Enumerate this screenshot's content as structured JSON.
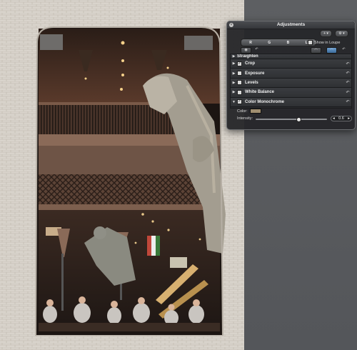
{
  "hud": {
    "title": "Adjustments",
    "close_glyph": "×",
    "toolbar_icons": [
      "add-icon",
      "gear-icon"
    ],
    "toolbar_glyphs": {
      "add": "+ ▾",
      "gear": "⚙ ▾"
    },
    "key_buttons": [
      "R",
      "G",
      "B",
      "L"
    ],
    "show_in_loupe_label": "Show in Loupe",
    "row2_glyphs": {
      "target": "◉",
      "undo": "↶",
      "eye_left": "◠",
      "eye_right": "◠",
      "revert": "↶"
    },
    "partial_row_label": "Straighten",
    "adjustments": [
      {
        "label": "Crop",
        "checked": true
      },
      {
        "label": "Exposure",
        "checked": false
      },
      {
        "label": "Levels",
        "checked": false
      },
      {
        "label": "White Balance",
        "checked": false
      },
      {
        "label": "Color Monochrome",
        "checked": true,
        "expanded": true
      }
    ],
    "collapsed_glyph": "▶",
    "expanded_glyph": "▼",
    "reset_glyph": "↶",
    "check_glyph": "✓",
    "color_label": "Color:",
    "color_swatch": "#a08e70",
    "intensity_label": "Intensity:",
    "intensity_value": "0.6",
    "intensity_fraction": 0.6,
    "stepper_left": "◂",
    "stepper_right": "▸"
  }
}
